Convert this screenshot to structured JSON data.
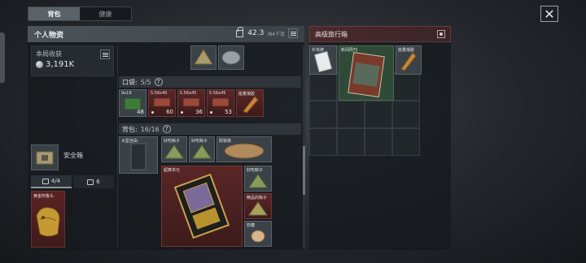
{
  "tabs": [
    {
      "label": "背包",
      "active": true
    },
    {
      "label": "健康",
      "active": false
    }
  ],
  "inventory": {
    "title": "个人物资",
    "weight_current": "42.3",
    "weight_max": "/84千克",
    "income_label": "本局收获",
    "income_value": "3,191K",
    "safe_label": "安全箱",
    "slot_a": "4/4",
    "slot_b": "6",
    "helmet_tag": "黄金阿鲁头"
  },
  "pockets": {
    "label": "口袋:",
    "count": "5/5",
    "items": [
      {
        "tag": "9x19",
        "qty": "48",
        "color": "green"
      },
      {
        "tag": "5.56x45",
        "qty": "60",
        "color": "red"
      },
      {
        "tag": "5.56x45",
        "qty": "36",
        "color": "red"
      },
      {
        "tag": "5.56x45",
        "qty": "53",
        "color": "red"
      },
      {
        "tag": "能量凝胶",
        "qty": "",
        "color": "red"
      }
    ]
  },
  "backpack": {
    "label": "背包:",
    "count": "16/16",
    "items": [
      {
        "tag": "大型自由",
        "color": "grey"
      },
      {
        "tag": "好吃粽子",
        "color": "grey"
      },
      {
        "tag": "好吃粽子",
        "color": "grey"
      },
      {
        "tag": "陨铁核",
        "color": "grey"
      },
      {
        "tag": "超算单元",
        "color": "red"
      },
      {
        "tag": "好吃粽子",
        "color": "grey"
      },
      {
        "tag": "精品的粽子",
        "color": "red"
      },
      {
        "tag": "奶糖",
        "color": "grey"
      }
    ]
  },
  "travel_case": {
    "title": "高级旅行箱",
    "items": [
      {
        "tag": "扑克牌"
      },
      {
        "tag": "新闻周刊"
      },
      {
        "tag": "能量凝胶"
      }
    ]
  },
  "colors": {
    "accent_red": "#5a2626",
    "panel": "#161a1d"
  }
}
